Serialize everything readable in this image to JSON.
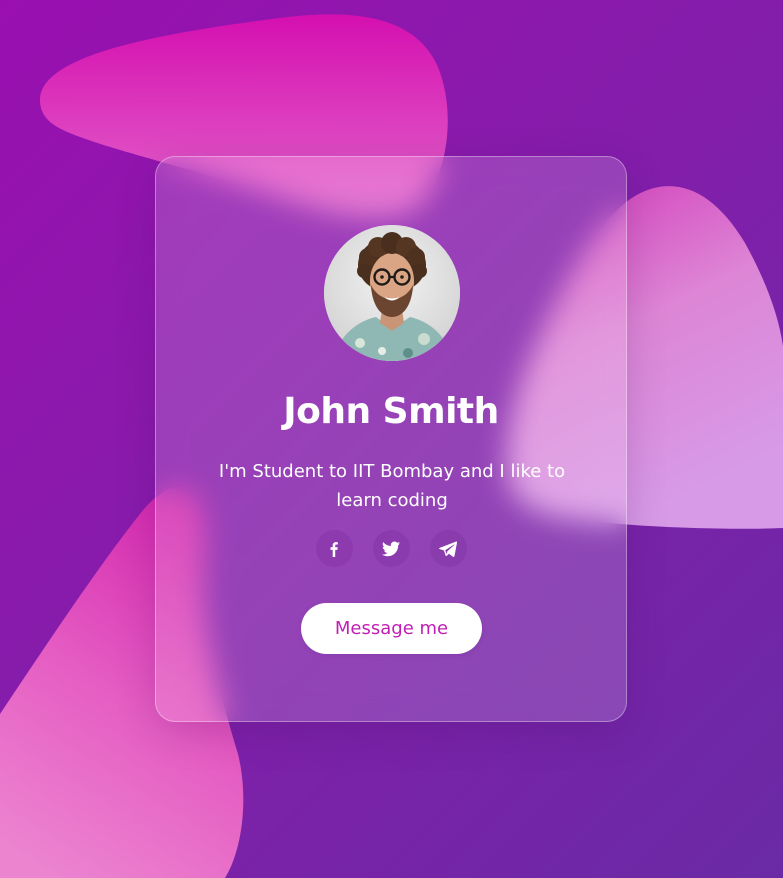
{
  "profile": {
    "name": "John Smith",
    "bio": "I'm Student to IIT Bombay and I like to learn coding",
    "avatar_alt": "Profile photo"
  },
  "socials": [
    {
      "icon": "facebook-icon"
    },
    {
      "icon": "twitter-icon"
    },
    {
      "icon": "telegram-icon"
    }
  ],
  "actions": {
    "message_label": "Message me"
  },
  "colors": {
    "background_start": "#9a0fb0",
    "background_end": "#6a2aa6",
    "blob_pink": "#f04fc0",
    "button_text": "#c01fb4",
    "button_bg": "#ffffff"
  }
}
